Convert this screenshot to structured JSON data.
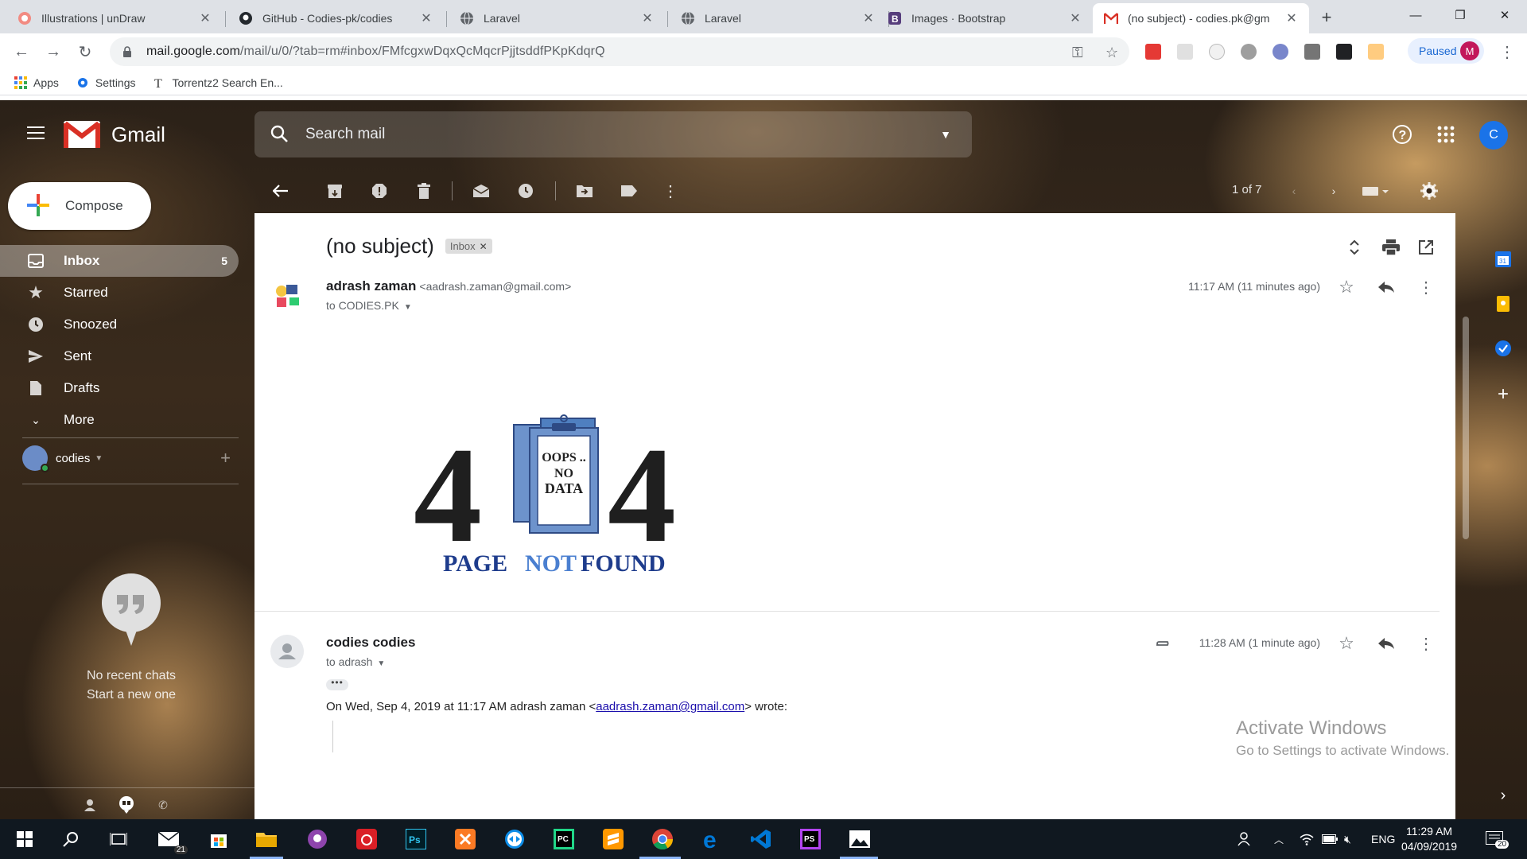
{
  "browser": {
    "tabs": [
      {
        "title": "Illustrations | unDraw",
        "icon": "undraw-icon"
      },
      {
        "title": "GitHub - Codies-pk/codies",
        "icon": "github-icon"
      },
      {
        "title": "Laravel",
        "icon": "globe-icon"
      },
      {
        "title": "Laravel",
        "icon": "globe-icon"
      },
      {
        "title": "Images · Bootstrap",
        "icon": "bootstrap-icon"
      },
      {
        "title": "(no subject) - codies.pk@gm",
        "icon": "gmail-icon"
      }
    ],
    "url_host": "mail.google.com",
    "url_path": "/mail/u/0/?tab=rm#inbox/FMfcgxwDqxQcMqcrPjjtsddfPKpKdqrQ",
    "profile_status": "Paused",
    "profile_initial": "M",
    "bookmarks": [
      "Apps",
      "Settings",
      "Torrentz2 Search En..."
    ]
  },
  "gmail": {
    "brand": "Gmail",
    "search_placeholder": "Search mail",
    "account_initial": "C",
    "compose_label": "Compose",
    "nav": [
      {
        "label": "Inbox",
        "count": "5",
        "icon": "inbox-icon"
      },
      {
        "label": "Starred",
        "count": "",
        "icon": "star-icon"
      },
      {
        "label": "Snoozed",
        "count": "",
        "icon": "clock-icon"
      },
      {
        "label": "Sent",
        "count": "",
        "icon": "send-icon"
      },
      {
        "label": "Drafts",
        "count": "",
        "icon": "draft-icon"
      },
      {
        "label": "More",
        "count": "",
        "icon": "chevron-down-icon"
      }
    ],
    "hangouts_user": "codies",
    "no_chats": "No recent chats",
    "start_chat": "Start a new one",
    "pager": "1 of 7",
    "thread": {
      "subject": "(no subject)",
      "label": "Inbox",
      "messages": [
        {
          "sender": "adrash zaman",
          "address": "<aadrash.zaman@gmail.com>",
          "to": "to CODIES.PK",
          "time": "11:17 AM (11 minutes ago)",
          "image": {
            "text_oops": "OOPS ..",
            "text_no": "NO",
            "text_data": "DATA",
            "digit": "4",
            "caption_page": "PAGE",
            "caption_not": "NOT",
            "caption_found": "FOUND"
          }
        },
        {
          "sender": "codies codies",
          "to": "to adrash",
          "time": "11:28 AM (1 minute ago)",
          "quote_prefix": "On Wed, Sep 4, 2019 at 11:17 AM adrash zaman <",
          "quote_email": "aadrash.zaman@gmail.com",
          "quote_suffix": "> wrote:"
        }
      ]
    }
  },
  "watermark": {
    "title": "Activate Windows",
    "subtitle": "Go to Settings to activate Windows."
  },
  "taskbar": {
    "mail_badge": "21",
    "lang": "ENG",
    "time": "11:29 AM",
    "date": "04/09/2019",
    "notif_count": "20"
  }
}
